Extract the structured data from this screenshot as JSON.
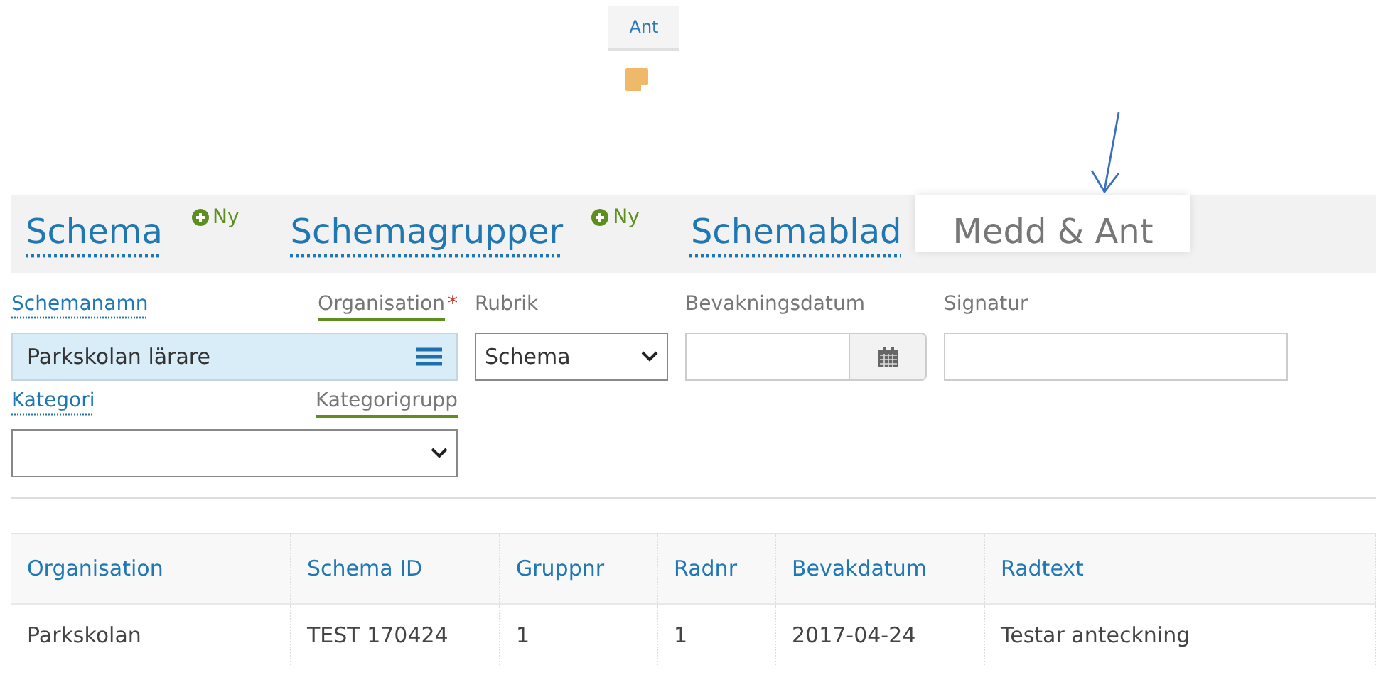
{
  "top_button": {
    "label": "Ant"
  },
  "tabs": [
    {
      "label": "Schema",
      "selected": false,
      "new_label": "Ny"
    },
    {
      "label": "Schemagrupper",
      "selected": false,
      "new_label": "Ny"
    },
    {
      "label": "Schemablad",
      "selected": false
    },
    {
      "label": "Medd & Ant",
      "selected": true
    }
  ],
  "form_rows": [
    [
      {
        "kind": "lookup",
        "labels": [
          {
            "text": "Schemanamn",
            "kind": "link"
          },
          {
            "text": "Organisation",
            "kind": "underlined",
            "required_mark": "*"
          }
        ],
        "value": "Parkskolan lärare"
      },
      {
        "kind": "select",
        "labels": [
          {
            "text": "Rubrik",
            "kind": "plain"
          }
        ],
        "value": "Schema"
      },
      {
        "kind": "date",
        "labels": [
          {
            "text": "Bevakningsdatum",
            "kind": "plain"
          }
        ]
      },
      {
        "kind": "text",
        "labels": [
          {
            "text": "Signatur",
            "kind": "plain"
          }
        ]
      }
    ],
    [
      {
        "kind": "select",
        "labels": [
          {
            "text": "Kategori",
            "kind": "link"
          },
          {
            "text": "Kategorigrupp",
            "kind": "underlined"
          }
        ]
      }
    ]
  ],
  "table": {
    "columns": [
      "Organisation",
      "Schema ID",
      "Gruppnr",
      "Radnr",
      "Bevakdatum",
      "Radtext"
    ],
    "rows": [
      [
        "Parkskolan",
        "TEST 170424",
        "1",
        "1",
        "2017-04-24",
        "Testar anteckning"
      ]
    ]
  }
}
